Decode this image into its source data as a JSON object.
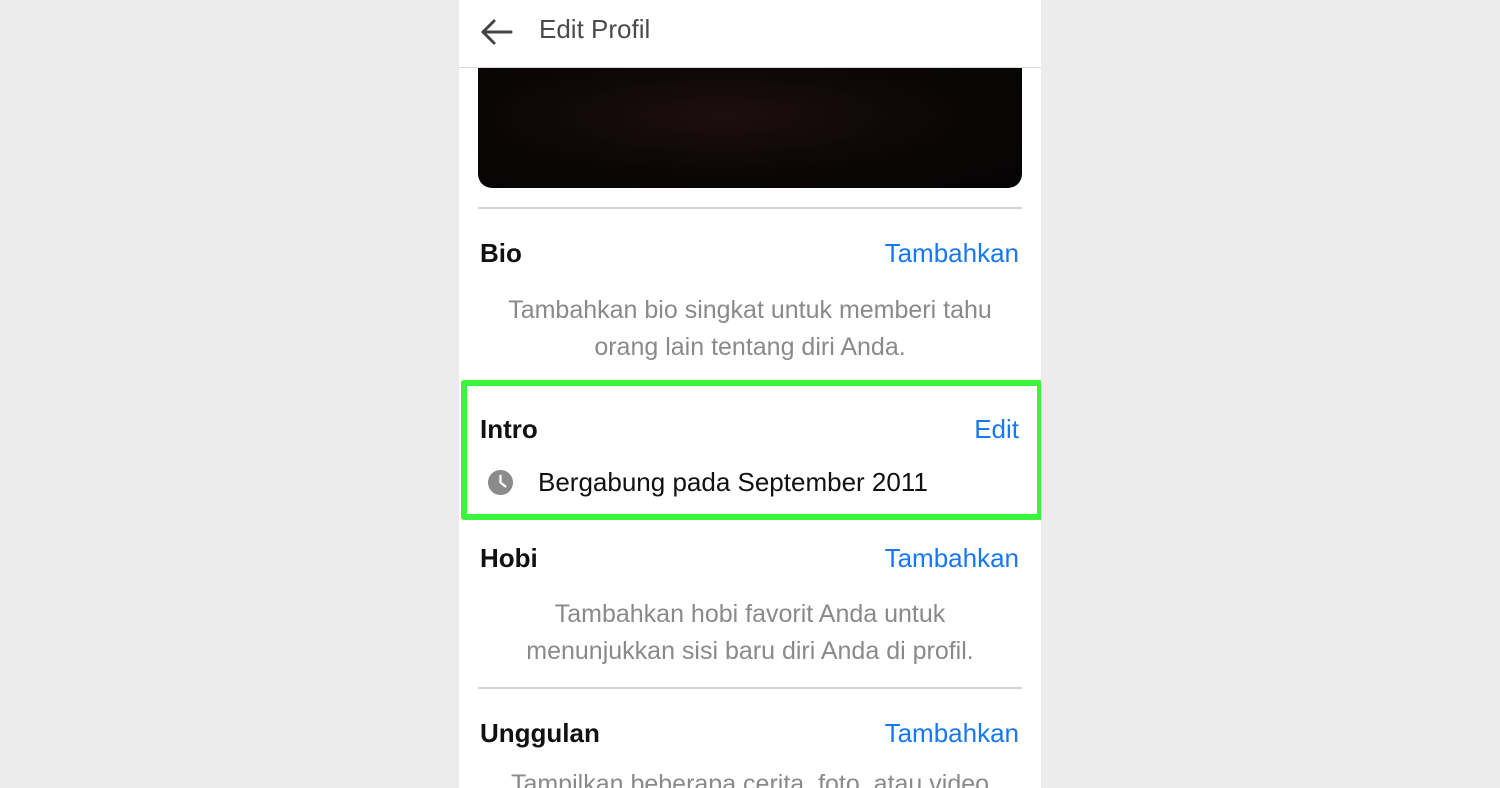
{
  "header": {
    "title": "Edit Profil",
    "back_icon": "arrow-left-icon"
  },
  "bio": {
    "title": "Bio",
    "action": "Tambahkan",
    "desc_line1": "Tambahkan bio singkat untuk memberi tahu",
    "desc_line2": "orang lain tentang diri Anda."
  },
  "intro": {
    "title": "Intro",
    "action": "Edit",
    "item_icon": "clock-icon",
    "item_text": "Bergabung pada September 2011"
  },
  "hobi": {
    "title": "Hobi",
    "action": "Tambahkan",
    "desc_line1": "Tambahkan hobi favorit Anda untuk",
    "desc_line2": "menunjukkan sisi baru diri Anda di profil."
  },
  "unggulan": {
    "title": "Unggulan",
    "action": "Tambahkan",
    "desc_line1": "Tampilkan beberapa cerita, foto, atau video"
  },
  "colors": {
    "accent": "#1877f2",
    "highlight": "#3cf43c",
    "background": "#ececec"
  }
}
